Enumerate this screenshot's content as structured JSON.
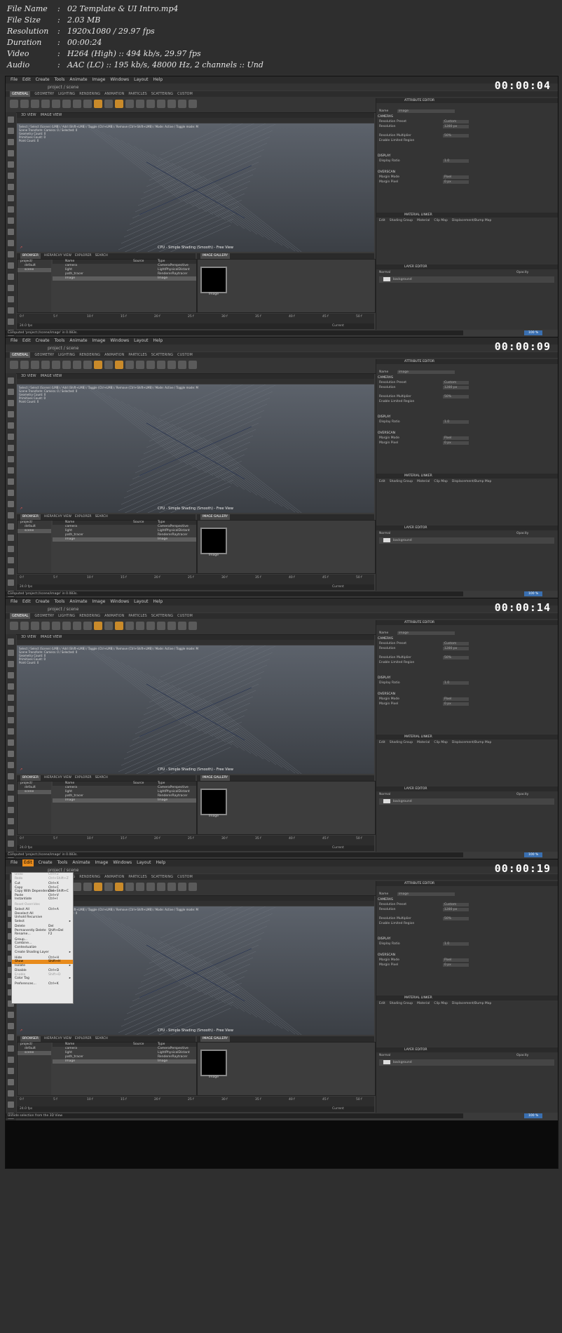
{
  "file_info": [
    {
      "key": "File Name",
      "value": "02 Template & UI Intro.mp4"
    },
    {
      "key": "File Size",
      "value": "2.03 MB"
    },
    {
      "key": "Resolution",
      "value": "1920x1080 / 29.97 fps"
    },
    {
      "key": "Duration",
      "value": "00:00:24"
    },
    {
      "key": "Video",
      "value": "H264 (High) :: 494 kb/s, 29.97 fps"
    },
    {
      "key": "Audio",
      "value": "AAC (LC) :: 195 kb/s, 48000 Hz, 2 channels :: Und"
    }
  ],
  "app": {
    "menu": [
      "File",
      "Edit",
      "Create",
      "Tools",
      "Animate",
      "Image",
      "Windows",
      "Layout",
      "Help"
    ],
    "path": "project / scene",
    "tabs": [
      "GENERAL",
      "GEOMETRY",
      "LIGHTING",
      "RENDERING",
      "ANIMATION",
      "PARTICLES",
      "SCATTERING",
      "CUSTOM"
    ],
    "viewport_tabs": [
      "3D VIEW",
      "IMAGE VIEW"
    ],
    "viewport_info": [
      "Select / Select (Scene) (LMB) / Add (Shift+LMB) / Toggle (Ctrl+LMB) / Remove (Ctrl+Shift+LMB) / Mode: Active / Toggle mode: M",
      "Scene Transform: Camera: 0 / Selected: 0",
      "Geometry Count: 0",
      "Primitives Count: 0",
      "Point Count: 0"
    ],
    "viewport_label": "CPU - Simple Shading (Smooth) - Free View",
    "browser_tabs": [
      "BROWSER",
      "HIERARCHY VIEW",
      "EXPLORER",
      "SEARCH"
    ],
    "gallery_tab": "IMAGE GALLERY",
    "tree": [
      "project/",
      "default",
      "scene"
    ],
    "table_headers": [
      "Name",
      "Source",
      "Type"
    ],
    "rows_frame1": [
      {
        "name": "camera",
        "type": "CameraPerspective"
      },
      {
        "name": "light",
        "type": "LightPhysicalDistant"
      },
      {
        "name": "path_tracer",
        "type": "RendererRaytracer"
      },
      {
        "name": "image",
        "type": "Image"
      }
    ],
    "thumb_label": "Image",
    "timeline_ticks": [
      "0 f",
      "5 f",
      "10 f",
      "15 f",
      "20 f",
      "25 f",
      "30 f",
      "35 f",
      "40 f",
      "45 f",
      "50 f"
    ],
    "fps": "24.0 fps",
    "current": "Current",
    "attr_title": "ATTRIBUTE EDITOR",
    "attr_name_label": "Name",
    "attr_name_value": "image",
    "attr_sections": {
      "camera": "CAMERAS",
      "display": "DISPLAY",
      "overscan": "OVERSCAN"
    },
    "attr_rows": [
      {
        "label": "Resolution Preset",
        "value": "Custom"
      },
      {
        "label": "Resolution",
        "value": "1280 px"
      },
      {
        "label": "Resolution Multiplier",
        "value": "50%"
      },
      {
        "label": "Enable Limited Region",
        "value": ""
      },
      {
        "label": "Display Ratio",
        "value": "1.0"
      },
      {
        "label": "Margin Mode",
        "value": "Pixel"
      },
      {
        "label": "Margin Pixel",
        "value": "0 px"
      }
    ],
    "material_title": "MATERIAL LINKER",
    "material_tabs": [
      "Edit",
      "Shading Group",
      "Material",
      "Clip Map",
      "Displacement/Bump Map"
    ],
    "layer_title": "LAYER EDITOR",
    "layer_mode": "Normal",
    "layer_opacity": "Opacity",
    "layer_name": "background",
    "status_text": "Computed 'project://scene/image' in 0.083s.",
    "status_text_4": "Unhide selection from the 3D View",
    "zoom": "100 %"
  },
  "frames": [
    {
      "timestamp": "00:00:04"
    },
    {
      "timestamp": "00:00:09"
    },
    {
      "timestamp": "00:00:14"
    },
    {
      "timestamp": "00:00:19"
    }
  ],
  "edit_menu": {
    "title": "Edit",
    "items": [
      {
        "label": "Undo",
        "shortcut": "Ctrl+Z",
        "disabled": true
      },
      {
        "label": "Redo",
        "shortcut": "Ctrl+Shift+Z",
        "disabled": true
      },
      {
        "sep": true
      },
      {
        "label": "Cut",
        "shortcut": "Ctrl+X"
      },
      {
        "label": "Copy",
        "shortcut": "Ctrl+C"
      },
      {
        "label": "Copy With Dependencies",
        "shortcut": "Ctrl+Shift+C"
      },
      {
        "label": "Paste",
        "shortcut": "Ctrl+V"
      },
      {
        "label": "Instantiate",
        "shortcut": "Ctrl+I"
      },
      {
        "sep": true
      },
      {
        "label": "Reset Overrides",
        "disabled": true
      },
      {
        "sep": true
      },
      {
        "label": "Select All",
        "shortcut": "Ctrl+A"
      },
      {
        "label": "Deselect All"
      },
      {
        "label": "Unhold Recursive"
      },
      {
        "label": "Select",
        "sub": true
      },
      {
        "sep": true
      },
      {
        "label": "Delete",
        "shortcut": "Del"
      },
      {
        "label": "Permanently Delete",
        "shortcut": "Shift+Del"
      },
      {
        "label": "Rename...",
        "shortcut": "F2"
      },
      {
        "sep": true
      },
      {
        "label": "Group..."
      },
      {
        "label": "Combine..."
      },
      {
        "label": "Contextualize"
      },
      {
        "sep": true
      },
      {
        "label": "Create Shading Layer",
        "sub": true
      },
      {
        "sep": true
      },
      {
        "label": "Hide",
        "shortcut": "Ctrl+H"
      },
      {
        "label": "Show",
        "shortcut": "Shift+H",
        "highlight": true
      },
      {
        "label": "Isolate",
        "sub": true
      },
      {
        "sep": true
      },
      {
        "label": "Disable",
        "shortcut": "Ctrl+D"
      },
      {
        "label": "Enable",
        "shortcut": "Shift+D",
        "disabled": true
      },
      {
        "label": "Color Tag",
        "sub": true
      },
      {
        "sep": true
      },
      {
        "label": "Preferences...",
        "shortcut": "Ctrl+K"
      }
    ]
  },
  "colors": {
    "accent": "#e88b1c",
    "background": "#2f2f2f",
    "viewport_top": "#5c626b",
    "viewport_bottom": "#3b3f45"
  }
}
